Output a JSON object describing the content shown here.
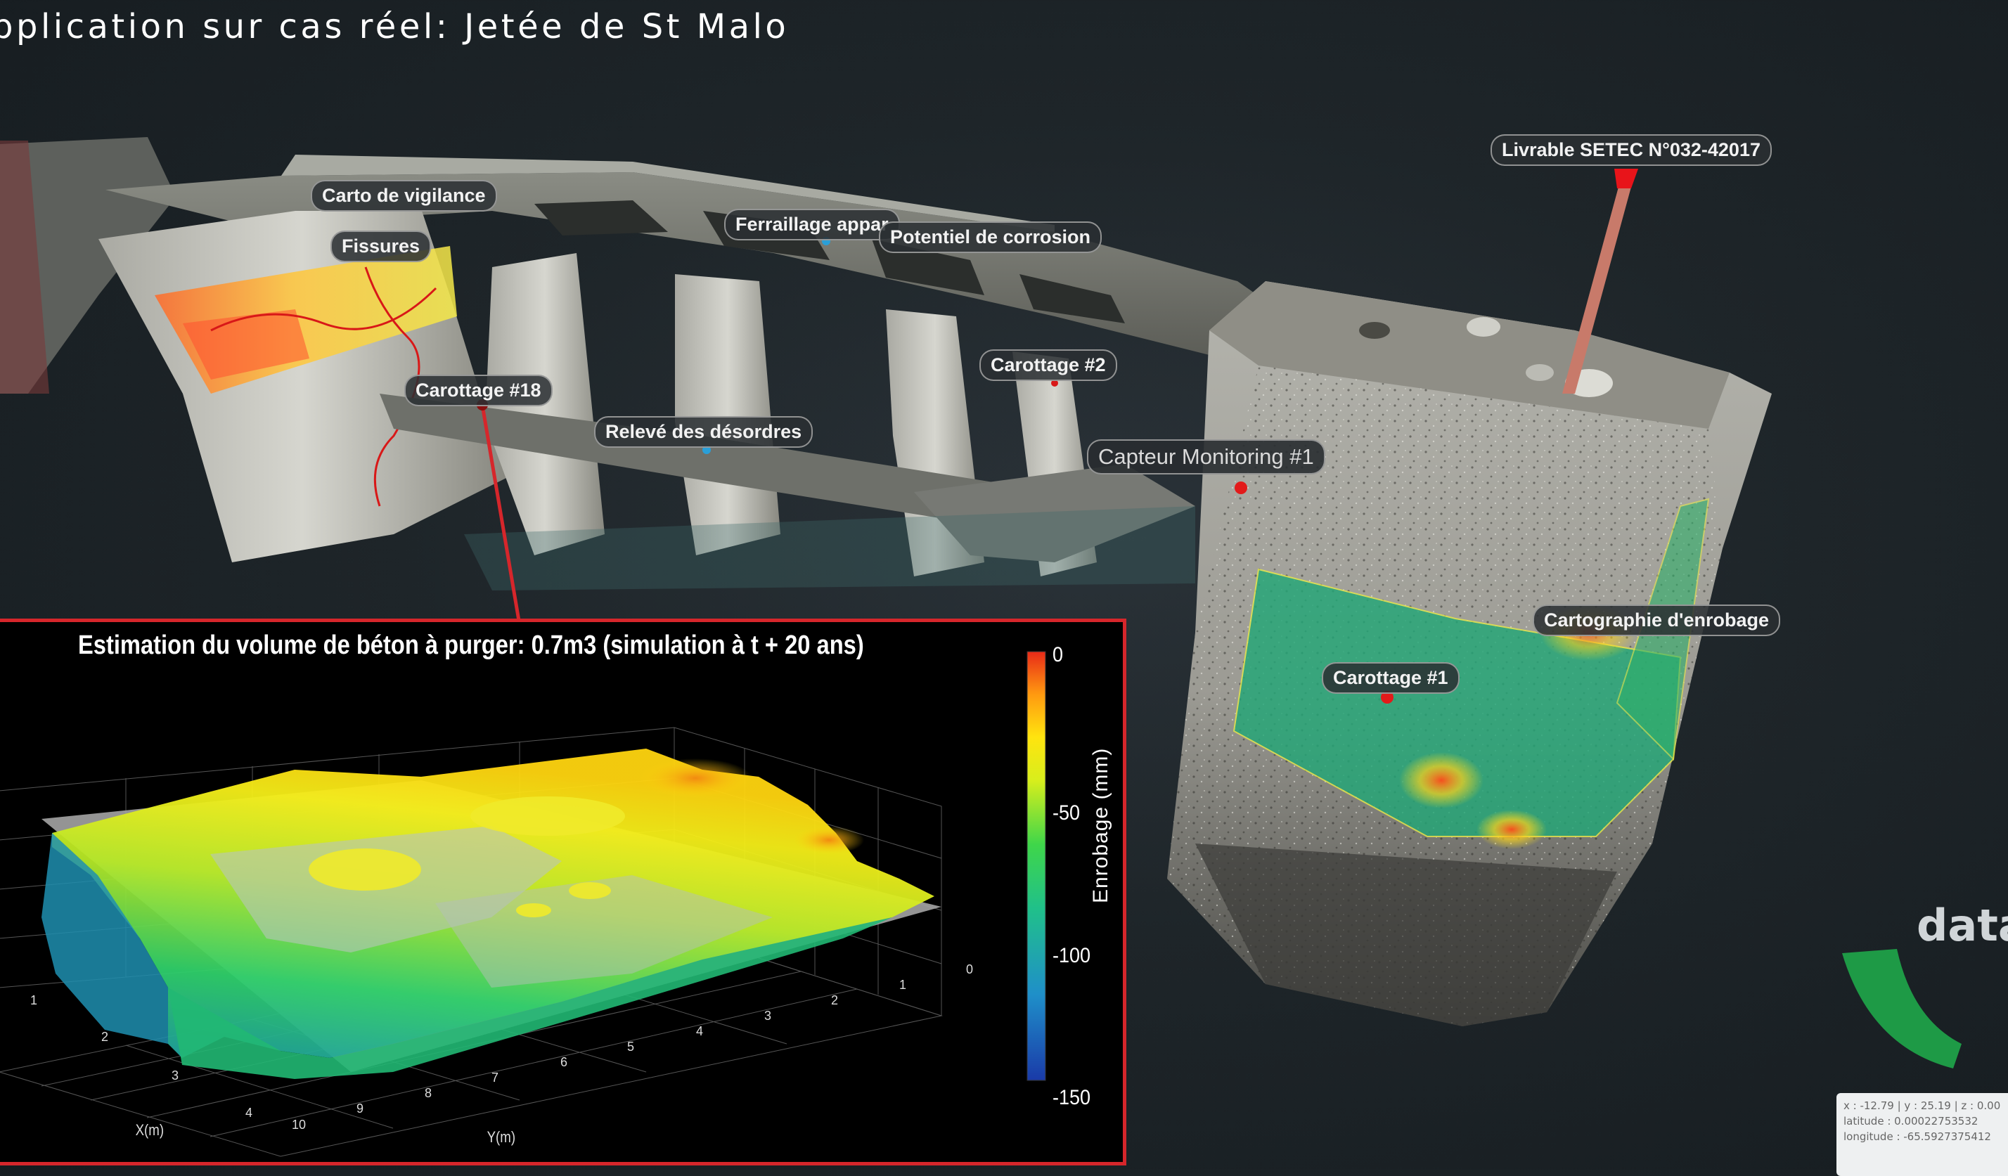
{
  "page": {
    "title": "pplication sur cas réel: Jetée de St Malo"
  },
  "colors": {
    "accent_red": "#d6262b",
    "brand_green": "#1e9a46",
    "tag_background": "#2a2e32",
    "background": "#1e2529"
  },
  "annotations": {
    "carto_vigilance": "Carto de vigilance",
    "fissures": "Fissures",
    "ferraillage": "Ferraillage appar",
    "potentiel_corrosion": "Potentiel de corrosion",
    "livrable": "Livrable SETEC N°032-42017",
    "carottage_18": "Carottage #18",
    "releve_desordres": "Relevé des désordres",
    "carottage_2": "Carottage #2",
    "capteur_monitoring": "Capteur Monitoring #1",
    "cartographie_enrobage": "Cartographie d'enrobage",
    "carottage_1": "Carottage #1"
  },
  "inset": {
    "title": "Estimation du volume de béton à purger: 0.7m3 (simulation à t + 20 ans)"
  },
  "chart_data": {
    "type": "surface",
    "title": "Estimation du volume de béton à purger: 0.7m3 (simulation à t + 20 ans)",
    "xlabel": "X(m)",
    "ylabel": "Y(m)",
    "colorbar_label": "Enrobage (mm)",
    "colorbar_ticks": [
      "0",
      "-50",
      "-100",
      "-150"
    ],
    "colorbar_range": [
      -150,
      0
    ],
    "x_ticks": [
      "1",
      "2",
      "3",
      "4"
    ],
    "y_ticks": [
      "10",
      "9",
      "8",
      "7",
      "6",
      "5",
      "4",
      "3",
      "2",
      "1",
      "0"
    ],
    "colormap": [
      "#1a3aa8",
      "#1f8fc9",
      "#20c08a",
      "#3fd64a",
      "#d8ee1c",
      "#ffe40f",
      "#ff9a10",
      "#e82a18"
    ],
    "grid": true
  },
  "brand": {
    "text": "data"
  },
  "status": {
    "coords_line": "x : -12.79 | y : 25.19 | z : 0.00",
    "latitude": "latitude : 0.00022753532",
    "longitude": "longitude : -65.5927375412"
  },
  "icons": {
    "marker": "map-pin-icon",
    "brand_mark": "brand-arc-icon"
  }
}
